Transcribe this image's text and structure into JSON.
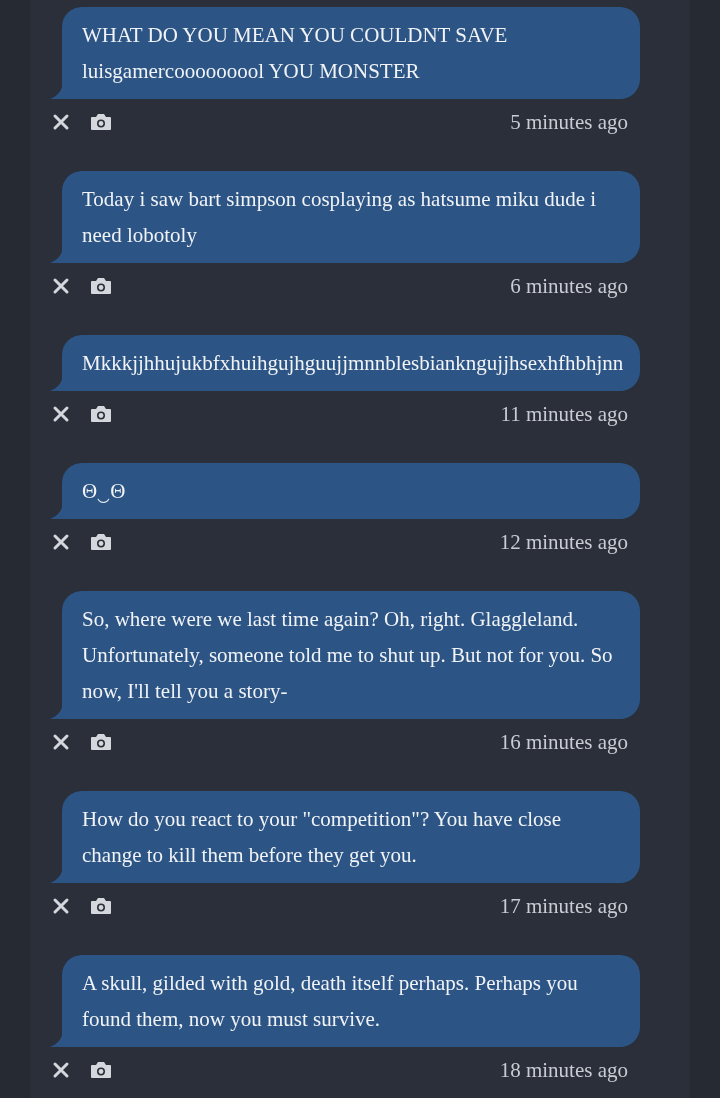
{
  "messages": [
    {
      "text": "WHAT DO YOU MEAN YOU COULDNT SAVE luisgamercooooooool YOU MONSTER",
      "time": "5 minutes ago"
    },
    {
      "text": "Today i saw bart simpson cosplaying as hatsume miku dude i need lobotoly",
      "time": "6 minutes ago"
    },
    {
      "text": "Mkkkjjhhujukbfxhuihgujhguujjmnnblesbiankngujjhsexhfhbhjnn",
      "time": "11 minutes ago",
      "kind": "overflow"
    },
    {
      "text": "Θ‿Θ",
      "time": "12 minutes ago"
    },
    {
      "text": "So, where were we last time again? Oh, right. Glaggleland. Unfortunately, someone told me to shut up. But not for you. So now, I'll tell you a story-",
      "time": "16 minutes ago"
    },
    {
      "text": "How do you react to your \"competition\"? You have close change to kill them before they get you.",
      "time": "17 minutes ago"
    },
    {
      "text": "A skull, gilded with gold, death itself perhaps. Perhaps you found them, now you must survive.",
      "time": "18 minutes ago"
    }
  ]
}
